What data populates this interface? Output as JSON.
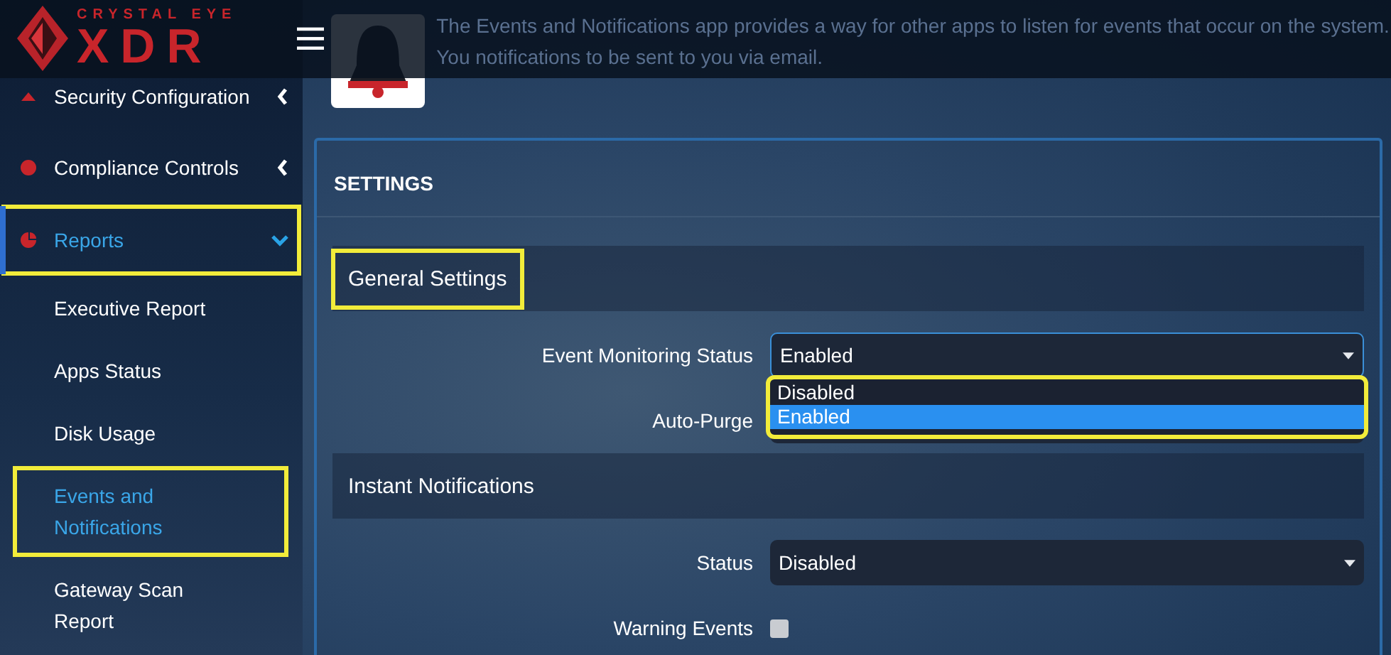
{
  "header": {
    "logo": {
      "tagline": "CRYSTAL EYE",
      "name": "XDR"
    },
    "app_description": "The Events and Notifications app provides a way for other apps to listen for events that occur on the system. You notifications to be sent to you via email."
  },
  "sidebar": {
    "items": [
      {
        "label": "Security Configuration",
        "expanded": false,
        "selected": false,
        "highlighted": false
      },
      {
        "label": "Compliance Controls",
        "expanded": false,
        "selected": false,
        "highlighted": false
      },
      {
        "label": "Reports",
        "expanded": true,
        "selected": true,
        "highlighted": true,
        "children": [
          {
            "label": "Executive Report",
            "selected": false,
            "highlighted": false
          },
          {
            "label": "Apps Status",
            "selected": false,
            "highlighted": false
          },
          {
            "label": "Disk Usage",
            "selected": false,
            "highlighted": false
          },
          {
            "label": "Events and Notifications",
            "selected": true,
            "highlighted": true
          },
          {
            "label": "Gateway Scan Report",
            "selected": false,
            "highlighted": false
          }
        ]
      }
    ]
  },
  "settings": {
    "title": "SETTINGS",
    "sections": [
      {
        "title": "General Settings",
        "highlighted": true,
        "fields": [
          {
            "label": "Event Monitoring Status",
            "kind": "select",
            "value": "Enabled",
            "dropdown": {
              "highlighted": true,
              "options": [
                {
                  "label": "Disabled",
                  "selected": false
                },
                {
                  "label": "Enabled",
                  "selected": true
                }
              ]
            }
          },
          {
            "label": "Auto-Purge",
            "kind": "select"
          }
        ]
      },
      {
        "title": "Instant Notifications",
        "highlighted": false,
        "fields": [
          {
            "label": "Status",
            "kind": "select",
            "value": "Disabled"
          },
          {
            "label": "Warning Events",
            "kind": "checkbox",
            "checked": false
          }
        ]
      }
    ]
  }
}
